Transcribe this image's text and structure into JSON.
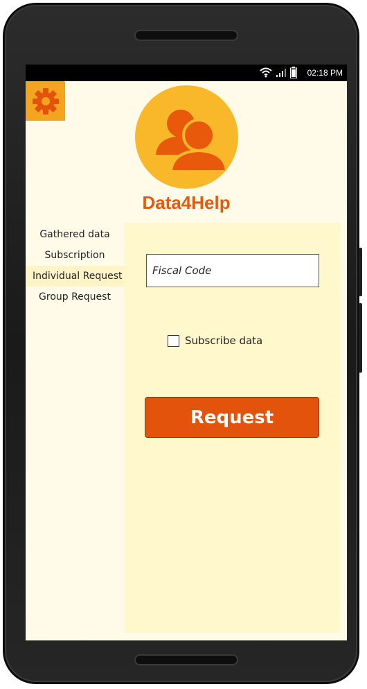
{
  "status_bar": {
    "time": "02:18 PM",
    "icons": [
      "wifi-icon",
      "signal-icon",
      "battery-icon"
    ]
  },
  "app": {
    "title": "Data4Help",
    "settings_icon": "gear-icon",
    "avatar_icon": "users-icon"
  },
  "nav": {
    "items": [
      {
        "label": "Gathered data",
        "active": false
      },
      {
        "label": "Subscription",
        "active": false
      },
      {
        "label": "Individual Request",
        "active": true
      },
      {
        "label": "Group Request",
        "active": false
      }
    ]
  },
  "form": {
    "fiscal_code_placeholder": "Fiscal Code",
    "fiscal_code_value": "",
    "subscribe_label": "Subscribe data",
    "subscribe_checked": false,
    "request_label": "Request"
  },
  "colors": {
    "accent": "#e3530b",
    "settings_bg": "#f3a51f",
    "avatar_bg": "#f9b82a",
    "panel_bg": "#fff8cc"
  }
}
